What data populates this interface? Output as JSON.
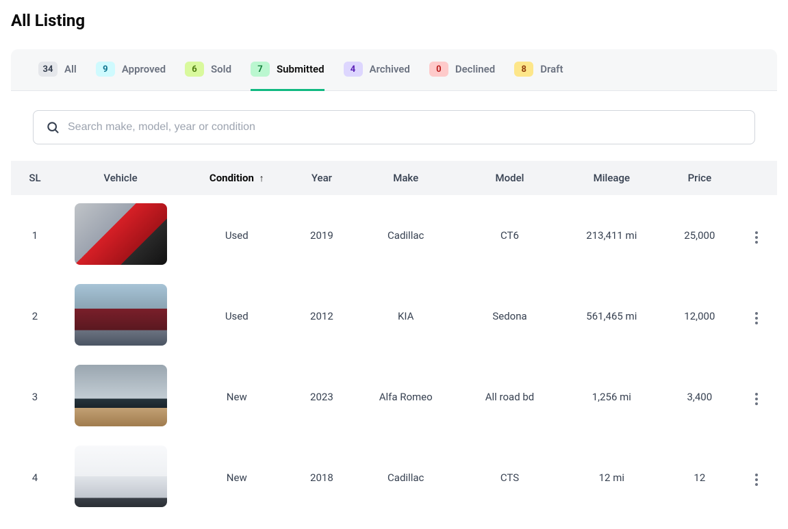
{
  "page": {
    "title": "All Listing"
  },
  "tabs": [
    {
      "key": "all",
      "label": "All",
      "count": "34",
      "badgeClass": "badge-all",
      "active": false
    },
    {
      "key": "approved",
      "label": "Approved",
      "count": "9",
      "badgeClass": "badge-approved",
      "active": false
    },
    {
      "key": "sold",
      "label": "Sold",
      "count": "6",
      "badgeClass": "badge-sold",
      "active": false
    },
    {
      "key": "submitted",
      "label": "Submitted",
      "count": "7",
      "badgeClass": "badge-submitted",
      "active": true
    },
    {
      "key": "archived",
      "label": "Archived",
      "count": "4",
      "badgeClass": "badge-archived",
      "active": false
    },
    {
      "key": "declined",
      "label": "Declined",
      "count": "0",
      "badgeClass": "badge-declined",
      "active": false
    },
    {
      "key": "draft",
      "label": "Draft",
      "count": "8",
      "badgeClass": "badge-draft",
      "active": false
    }
  ],
  "search": {
    "placeholder": "Search make, model, year or condition",
    "value": ""
  },
  "table": {
    "columns": {
      "sl": "SL",
      "vehicle": "Vehicle",
      "condition": "Condition",
      "year": "Year",
      "make": "Make",
      "model": "Model",
      "mileage": "Mileage",
      "price": "Price"
    },
    "sort": {
      "column": "condition",
      "direction": "asc"
    },
    "rows": [
      {
        "sl": "1",
        "imgClass": "vimg1",
        "condition": "Used",
        "year": "2019",
        "make": "Cadillac",
        "model": "CT6",
        "mileage": "213,411 mi",
        "price": "25,000"
      },
      {
        "sl": "2",
        "imgClass": "vimg2",
        "condition": "Used",
        "year": "2012",
        "make": "KIA",
        "model": "Sedona",
        "mileage": "561,465 mi",
        "price": "12,000"
      },
      {
        "sl": "3",
        "imgClass": "vimg3",
        "condition": "New",
        "year": "2023",
        "make": "Alfa Romeo",
        "model": "All road bd",
        "mileage": "1,256 mi",
        "price": "3,400"
      },
      {
        "sl": "4",
        "imgClass": "vimg4",
        "condition": "New",
        "year": "2018",
        "make": "Cadillac",
        "model": "CTS",
        "mileage": "12 mi",
        "price": "12"
      }
    ]
  }
}
